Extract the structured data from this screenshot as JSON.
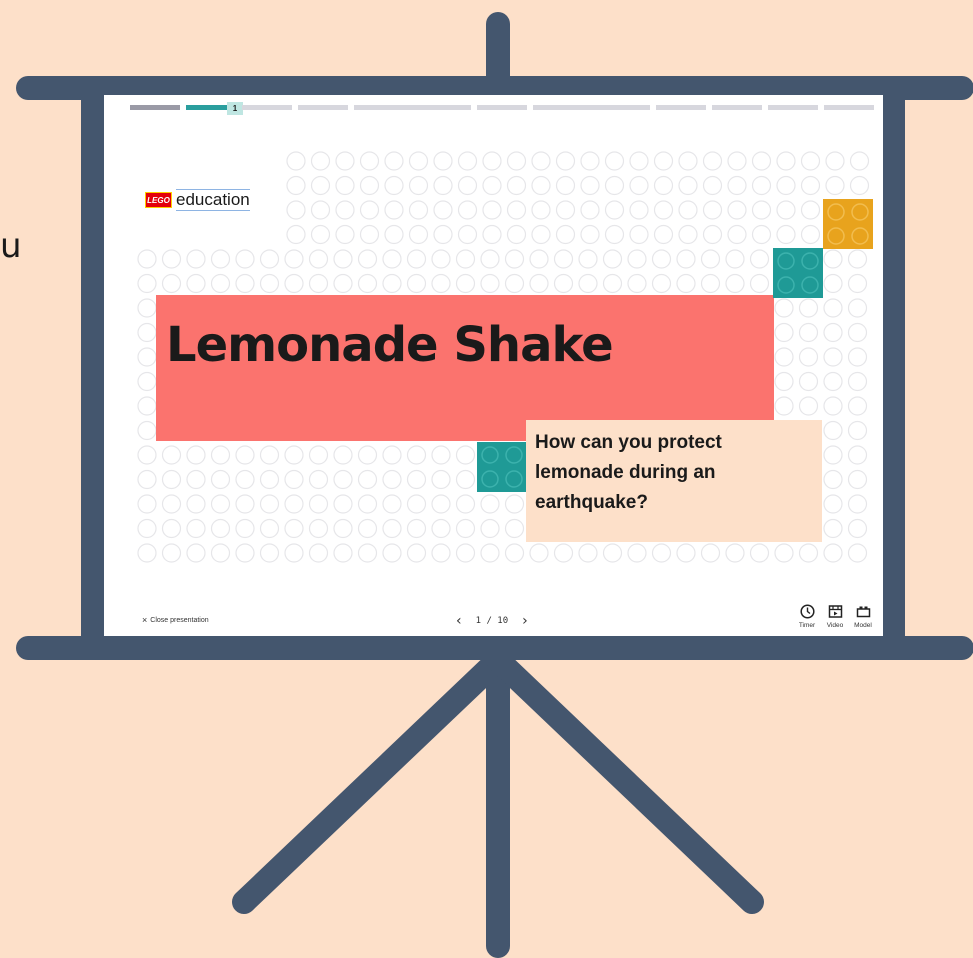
{
  "background_text": "u",
  "progress": {
    "current_page_label": "1"
  },
  "slide": {
    "logo_brick_text": "LEGO",
    "logo_text": "education",
    "title": "Lemonade Shake",
    "question": "How can you protect lemonade during an earthquake?"
  },
  "footer": {
    "close_label": "Close presentation",
    "close_icon": "×",
    "prev_icon": "‹",
    "page_indicator": "1 / 10",
    "next_icon": "›",
    "tools": [
      {
        "label": "Timer",
        "icon": "clock-icon"
      },
      {
        "label": "Video",
        "icon": "video-icon"
      },
      {
        "label": "Model",
        "icon": "model-icon"
      }
    ]
  },
  "colors": {
    "background": "#fde0c9",
    "easel": "#44566e",
    "title_block": "#fb736e",
    "teal_brick": "#1f9a96",
    "yellow_brick": "#e8a31d",
    "question_box": "#fde0c9"
  }
}
